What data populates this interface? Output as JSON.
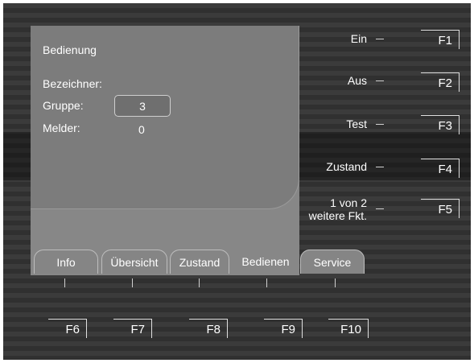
{
  "panel": {
    "title": "Bedienung",
    "fields": {
      "bezeichner_label": "Bezeichner:",
      "gruppe_label": "Gruppe:",
      "gruppe_value": "3",
      "melder_label": "Melder:",
      "melder_value": "0"
    }
  },
  "tabs": [
    {
      "label": "Info",
      "active": false
    },
    {
      "label": "Übersicht",
      "active": false
    },
    {
      "label": "Zustand",
      "active": false
    },
    {
      "label": "Bedienen",
      "active": true
    },
    {
      "label": "Service",
      "active": false
    }
  ],
  "side_functions": [
    {
      "label": "Ein",
      "key": "F1"
    },
    {
      "label": "Aus",
      "key": "F2"
    },
    {
      "label": "Test",
      "key": "F3"
    },
    {
      "label": "Zustand",
      "key": "F4"
    },
    {
      "label_line1": "1 von 2",
      "label_line2": "weitere Fkt.",
      "key": "F5"
    }
  ],
  "bottom_keys": [
    "F6",
    "F7",
    "F8",
    "F9",
    "F10"
  ]
}
